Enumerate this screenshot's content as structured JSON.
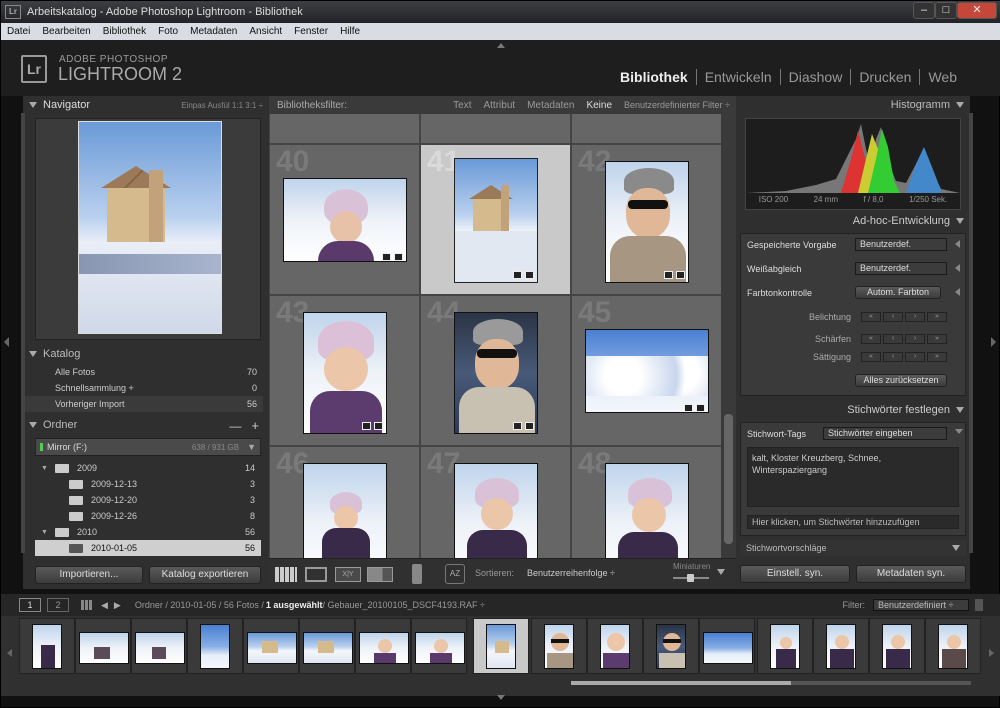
{
  "window": {
    "title": "Arbeitskatalog - Adobe Photoshop Lightroom - Bibliothek",
    "app_icon": "Lr",
    "minimize": "–",
    "maximize": "□",
    "close": "✕"
  },
  "menu": [
    "Datei",
    "Bearbeiten",
    "Bibliothek",
    "Foto",
    "Metadaten",
    "Ansicht",
    "Fenster",
    "Hilfe"
  ],
  "brand": {
    "line1": "ADOBE PHOTOSHOP",
    "line2": "LIGHTROOM 2",
    "logo": "Lr"
  },
  "modules": [
    "Bibliothek",
    "Entwickeln",
    "Diashow",
    "Drucken",
    "Web"
  ],
  "navigator": {
    "title": "Navigator",
    "modes": "Einpas  Ausfül  1:1  3:1 ÷"
  },
  "katalog": {
    "title": "Katalog",
    "items": [
      {
        "label": "Alle Fotos",
        "count": "70"
      },
      {
        "label": "Schnellsammlung +",
        "count": "0"
      },
      {
        "label": "Vorheriger Import",
        "count": "56"
      }
    ]
  },
  "ordner": {
    "title": "Ordner",
    "minus": "—",
    "plus": "+",
    "drive": "Mirror (F:)",
    "drive_size": "638 / 931 GB",
    "folders": [
      {
        "label": "2009",
        "count": "14",
        "level": 0
      },
      {
        "label": "2009-12-13",
        "count": "3",
        "level": 1
      },
      {
        "label": "2009-12-20",
        "count": "3",
        "level": 1
      },
      {
        "label": "2009-12-26",
        "count": "8",
        "level": 1
      },
      {
        "label": "2010",
        "count": "56",
        "level": 0
      },
      {
        "label": "2010-01-05",
        "count": "56",
        "level": 1
      }
    ]
  },
  "left_buttons": {
    "import": "Importieren...",
    "export": "Katalog exportieren"
  },
  "filterbar": {
    "title": "Bibliotheksfilter:",
    "items": [
      "Text",
      "Attribut",
      "Metadaten",
      "Keine"
    ],
    "custom": "Benutzerdefinierter Filter ÷"
  },
  "grid": {
    "numbers": [
      "40",
      "41",
      "42",
      "43",
      "44",
      "45",
      "46",
      "47",
      "48"
    ]
  },
  "toolbar": {
    "sort_label": "Sortieren:",
    "sort_value": "Benutzerreihenfolge ÷",
    "thumb_label": "Miniaturen",
    "az": "AZ"
  },
  "histogram": {
    "title": "Histogramm",
    "iso": "ISO 200",
    "focal": "24 mm",
    "aperture": "f / 8,0",
    "shutter": "1/250 Sek."
  },
  "quickdev": {
    "title": "Ad-hoc-Entwicklung",
    "preset_label": "Gespeicherte Vorgabe",
    "preset_value": "Benutzerdef.",
    "wb_label": "Weißabgleich",
    "wb_value": "Benutzerdef.",
    "tone_label": "Farbtonkontrolle",
    "tone_button": "Autom. Farbton",
    "exposure": "Belichtung",
    "sharp": "Schärfen",
    "saturation": "Sättigung",
    "reset": "Alles zurücksetzen",
    "steps": [
      "«",
      "‹",
      "›",
      "»"
    ]
  },
  "keywords": {
    "title": "Stichwörter festlegen",
    "tag_label": "Stichwort-Tags",
    "tag_value": "Stichwörter eingeben",
    "text": "kalt, Kloster Kreuzberg, Schnee, Winterspaziergang",
    "hint": "Hier klicken, um Stichwörter hinzuzufügen",
    "suggest": "Stichwortvorschläge"
  },
  "right_buttons": {
    "sync": "Einstell. syn.",
    "meta": "Metadaten syn."
  },
  "filmstrip_bar": {
    "page1": "1",
    "page2": "2",
    "path_prefix": "Ordner / 2010-01-05 / 56 Fotos / ",
    "path_sel": "1 ausgewählt",
    "path_file": " / Gebauer_20100105_DSCF4193.RAF ÷",
    "filter_label": "Filter:",
    "filter_value": "Benutzerdefiniert ÷"
  }
}
